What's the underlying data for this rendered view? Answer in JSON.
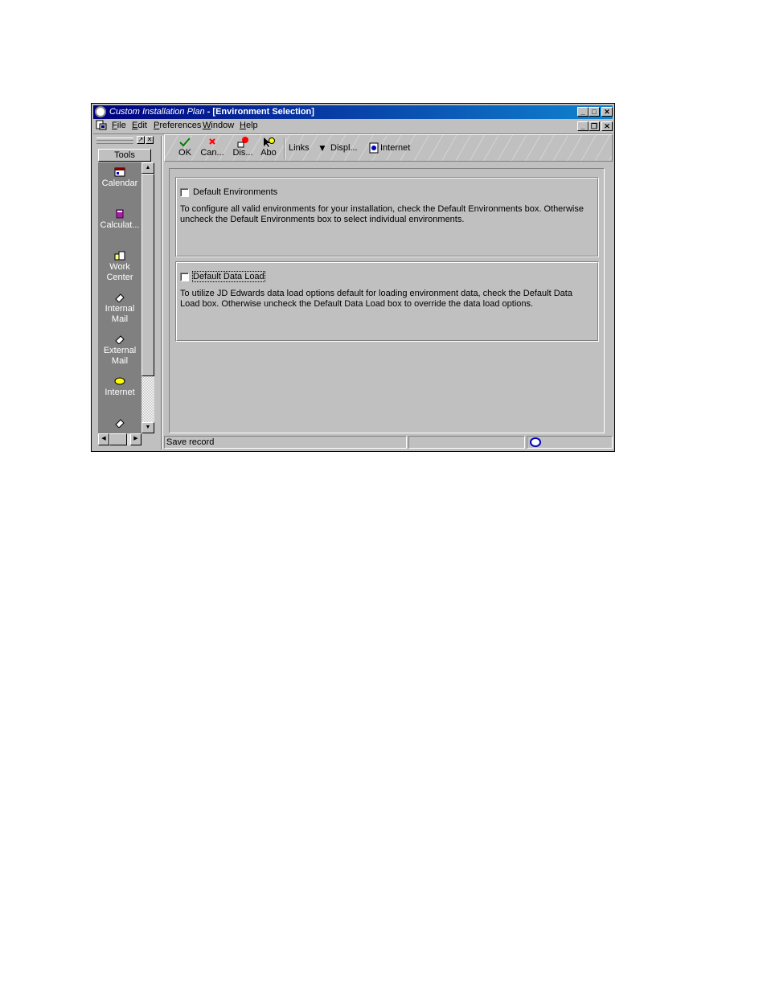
{
  "window": {
    "app_title": "Custom Installation Plan",
    "title_rest": " - [Environment Selection]",
    "min_symbol": "_",
    "max_symbol": "□",
    "close_symbol": "✕",
    "restore_symbol": "❐"
  },
  "menu": {
    "items": [
      {
        "key": "F",
        "rest": "ile"
      },
      {
        "key": "E",
        "rest": "dit"
      },
      {
        "key": "P",
        "rest": "references"
      },
      {
        "key": "W",
        "rest": "indow"
      },
      {
        "key": "H",
        "rest": "elp"
      }
    ]
  },
  "tools_pane": {
    "header": "Tools",
    "items": [
      {
        "label": "Calendar",
        "icon": "calendar-icon"
      },
      {
        "label": "Calculat...",
        "icon": "calculator-icon"
      },
      {
        "label": "Work Center",
        "icon": "work-center-icon"
      },
      {
        "label": "Internal Mail",
        "icon": "internal-mail-icon"
      },
      {
        "label": "External Mail",
        "icon": "external-mail-icon"
      },
      {
        "label": "Internet",
        "icon": "internet-icon"
      },
      {
        "label": "",
        "icon": "tool-icon"
      }
    ],
    "up_arrow": "▲",
    "down_arrow": "▼",
    "left_arrow": "◀",
    "right_arrow": "▶"
  },
  "toolbar": {
    "ok": "OK",
    "cancel": "Can...",
    "display": "Dis...",
    "about": "Abo",
    "links": "Links",
    "display_menu": "Displ...",
    "internet": "Internet"
  },
  "form": {
    "group1": {
      "checkbox_label": "Default Environments",
      "checked": false,
      "line1": "To configure all valid environments for your installation, check the Default Environments box.  Otherwise",
      "line2": "uncheck the Default Environments box to select individual environments."
    },
    "group2": {
      "checkbox_label": "Default Data Load",
      "checked": false,
      "line1": "To utilize JD Edwards data load options default for loading environment data, check the Default Data",
      "line2": "Load box.  Otherwise uncheck the Default Data Load box to override the data load options."
    }
  },
  "status": {
    "message": "Save record"
  },
  "colors": {
    "title_start": "#000080",
    "title_end": "#1084d0",
    "face": "#c0c0c0",
    "tools_bg": "#808080"
  }
}
